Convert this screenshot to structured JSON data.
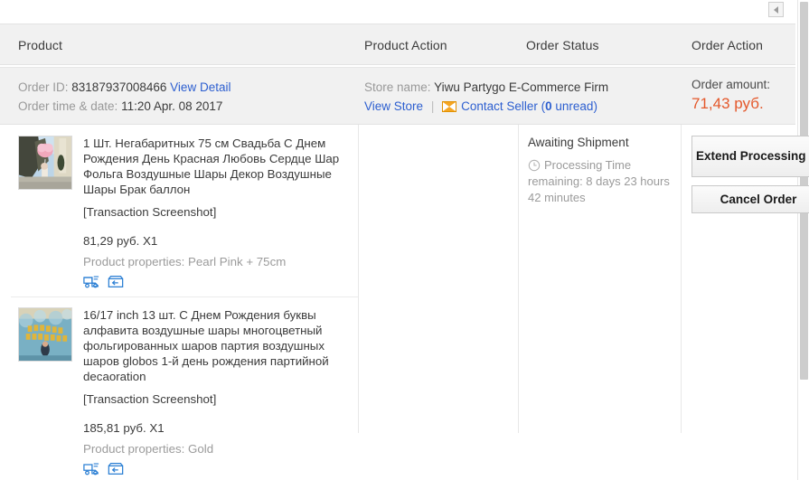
{
  "scrollbars": {
    "h_left_arrow_icon": "triangle-left-icon",
    "v_scrollbar_name": "vertical-scrollbar"
  },
  "table": {
    "headers": {
      "product": "Product",
      "product_action": "Product Action",
      "order_status": "Order Status",
      "order_action": "Order Action"
    }
  },
  "order": {
    "order_id_label": "Order ID:",
    "order_id_value": "83187937008466",
    "view_detail": "View Detail",
    "order_time_label": "Order time & date:",
    "order_time_value": "11:20 Apr. 08 2017",
    "store_name_label": "Store name:",
    "store_name_value": "Yiwu Partygo E-Commerce Firm",
    "view_store": "View Store",
    "divider": "|",
    "contact_seller_icon": "envelope-icon",
    "contact_seller_pre": "Contact Seller (",
    "contact_seller_count": "0",
    "contact_seller_post": " unread)",
    "amount_label": "Order amount:",
    "amount_value": "71,43 руб.",
    "amount_color": "#e4582b"
  },
  "products": [
    {
      "thumb_alt": "pink-heart-balloons-photo",
      "title": "1 Шт. Негабаритных 75 см Свадьба С Днем Рождения День Красная Любовь Сердце Шар Фольга Воздушные Шары Декор Воздушные Шары Брак баллон",
      "screenshot_label": "[Transaction Screenshot]",
      "price": "81,29 руб. X1",
      "properties": "Product properties: Pearl Pink + 75cm",
      "icons": [
        "shipping-truck-icon",
        "return-box-icon"
      ]
    },
    {
      "thumb_alt": "happy-birthday-foil-balloons-photo",
      "title": "16/17 inch 13 шт. С Днем Рождения буквы алфавита воздушные шары многоцветный фольгированных шаров партия воздушных шаров globos 1-й день рождения партийной decaoration",
      "screenshot_label": "[Transaction Screenshot]",
      "price": "185,81 руб. X1",
      "properties": "Product properties: Gold",
      "icons": [
        "shipping-truck-icon",
        "return-box-icon"
      ]
    }
  ],
  "status": {
    "title": "Awaiting Shipment",
    "clock_icon": "clock-icon",
    "processing_text": "Processing Time remaining: 8 days 23 hours 42 minutes"
  },
  "actions": {
    "extend": "Extend Processing Time",
    "cancel": "Cancel Order"
  }
}
